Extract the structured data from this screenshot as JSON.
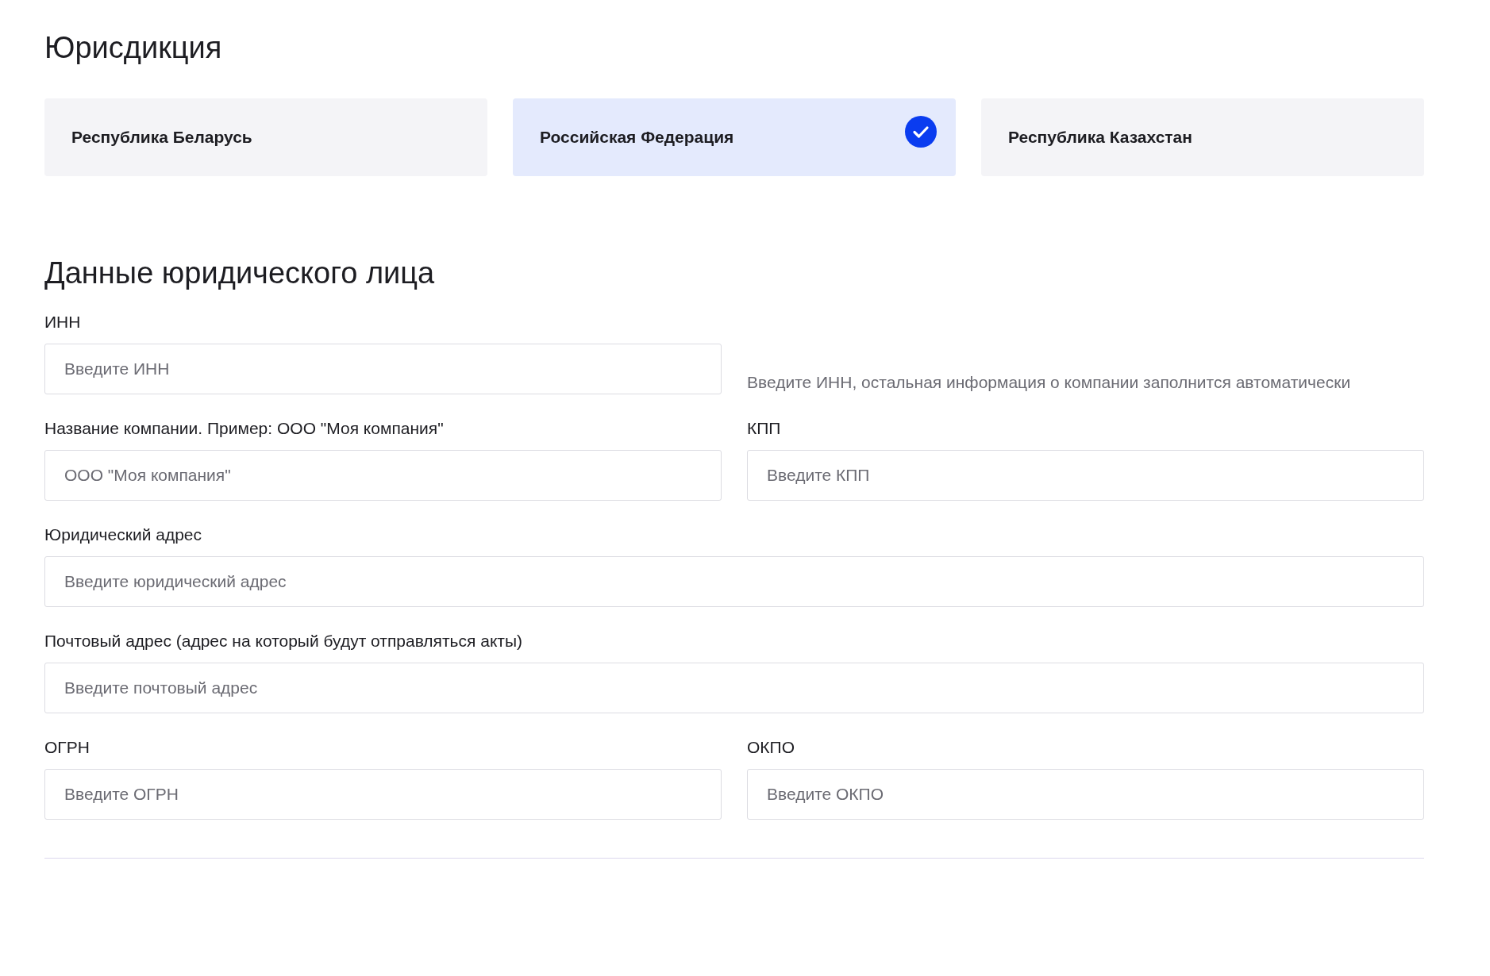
{
  "jurisdiction": {
    "title": "Юрисдикция",
    "options": [
      {
        "label": "Республика Беларусь",
        "selected": false
      },
      {
        "label": "Российская Федерация",
        "selected": true
      },
      {
        "label": "Республика Казахстан",
        "selected": false
      }
    ]
  },
  "entity": {
    "title": "Данные юридического лица",
    "rows": [
      {
        "items": [
          {
            "kind": "field",
            "label": "ИНН",
            "placeholder": "Введите ИНН"
          },
          {
            "kind": "hint",
            "text": "Введите ИНН, остальная информация о компании заполнится автоматически"
          }
        ]
      },
      {
        "items": [
          {
            "kind": "field",
            "label": "Название компании. Пример: ООО \"Моя компания\"",
            "placeholder": "ООО \"Моя компания\""
          },
          {
            "kind": "field",
            "label": "КПП",
            "placeholder": "Введите КПП"
          }
        ]
      },
      {
        "items": [
          {
            "kind": "field",
            "label": "Юридический адрес",
            "placeholder": "Введите юридический адрес"
          }
        ]
      },
      {
        "items": [
          {
            "kind": "field",
            "label": "Почтовый адрес (адрес на который будут отправляться акты)",
            "placeholder": "Введите почтовый адрес"
          }
        ]
      },
      {
        "items": [
          {
            "kind": "field",
            "label": "ОГРН",
            "placeholder": "Введите ОГРН"
          },
          {
            "kind": "field",
            "label": "ОКПО",
            "placeholder": "Введите ОКПО"
          }
        ]
      }
    ]
  }
}
